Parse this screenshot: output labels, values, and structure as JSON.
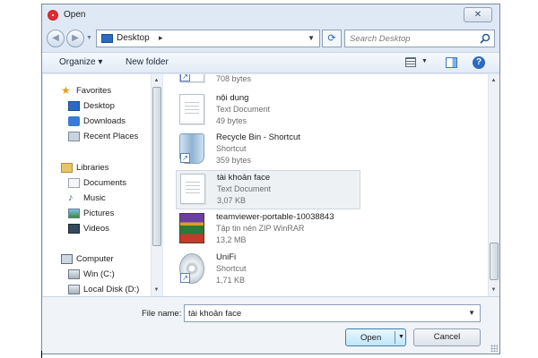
{
  "window": {
    "title": "Open",
    "close_symbol": "✕"
  },
  "nav": {
    "back_symbol": "◀",
    "forward_symbol": "▶",
    "address": "Desktop",
    "search_placeholder": "Search Desktop"
  },
  "toolbar": {
    "organize": "Organize ▾",
    "new_folder": "New folder",
    "help": "?"
  },
  "sidebar": {
    "favorites": "Favorites",
    "desktop": "Desktop",
    "downloads": "Downloads",
    "recent_places": "Recent Places",
    "libraries": "Libraries",
    "documents": "Documents",
    "music": "Music",
    "pictures": "Pictures",
    "videos": "Videos",
    "computer": "Computer",
    "win_c": "Win (C:)",
    "local_disk_d": "Local Disk (D:)"
  },
  "files": [
    {
      "name": "",
      "type": "",
      "size": "708 bytes",
      "icon": "shortcut-icon"
    },
    {
      "name": "nội dung",
      "type": "Text Document",
      "size": "49 bytes",
      "icon": "text-document-icon"
    },
    {
      "name": "Recycle Bin - Shortcut",
      "type": "Shortcut",
      "size": "359 bytes",
      "icon": "recycle-bin-icon"
    },
    {
      "name": "tài khoản face",
      "type": "Text Document",
      "size": "3,07 KB",
      "icon": "text-document-icon",
      "selected": true
    },
    {
      "name": "teamviewer-portable-10038843",
      "type": "Tập tin nén ZIP WinRAR",
      "size": "13,2 MB",
      "icon": "winrar-archive-icon"
    },
    {
      "name": "UniFi",
      "type": "Shortcut",
      "size": "1,71 KB",
      "icon": "disc-icon"
    }
  ],
  "footer": {
    "file_name_label": "File name:",
    "file_name_value": "tài khoản face",
    "open_label": "Open",
    "cancel_label": "Cancel"
  },
  "colors": {
    "selected_bg": "#eef1f4",
    "accent": "#3c7fb1",
    "app_icon": "#d8282e"
  }
}
